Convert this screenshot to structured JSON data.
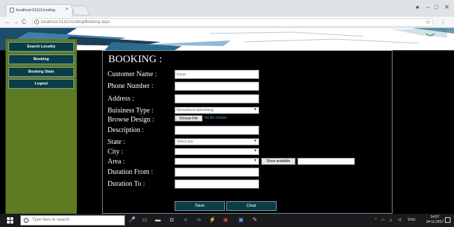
{
  "browser": {
    "tab_title": "localhost:51121/coding",
    "tab_close": "×",
    "url": "localhost:51121/coding/Booking.aspx",
    "back_icon": "arrow-left-icon",
    "forward_icon": "arrow-right-icon",
    "reload_icon": "reload-icon",
    "window_controls": {
      "minimize": "–",
      "maximize": "□",
      "close": "✕"
    }
  },
  "sidebar": {
    "items": [
      {
        "label": "Search Locality"
      },
      {
        "label": "Booking"
      },
      {
        "label": "Booking Stats"
      },
      {
        "label": "Logout"
      }
    ]
  },
  "form": {
    "heading": "BOOKING :",
    "customer_name": {
      "label": "Customer Name :",
      "value": "Karan"
    },
    "phone_number": {
      "label": "Phone Number :",
      "value": ""
    },
    "address": {
      "label": "Address :",
      "value": ""
    },
    "business_type": {
      "label": "Buisiness Type :",
      "value": "Recruitment advertising"
    },
    "browse_design": {
      "label": "Browse Design :",
      "button": "Choose File",
      "status": "No file chosen"
    },
    "description": {
      "label": "Description :",
      "value": ""
    },
    "state": {
      "label": "State :",
      "value": "Select any"
    },
    "city": {
      "label": "City :",
      "value": ""
    },
    "area": {
      "label": "Area :",
      "value": "",
      "show_button": "Show available"
    },
    "duration_from": {
      "label": "Duration From :",
      "value": ""
    },
    "duration_to": {
      "label": "Duration To :",
      "value": ""
    },
    "save_button": "Save",
    "clear_button": "Clear"
  },
  "taskbar": {
    "search_placeholder": "Type here to search",
    "language": "ENG",
    "time": "14:57",
    "date": "14-11-2017"
  },
  "colors": {
    "page_background": "#000000",
    "sidebar": "#5e7a22",
    "nav_button": "#0b3d46",
    "action_button": "#0b3d46",
    "taskbar": "#1b1b1f"
  }
}
